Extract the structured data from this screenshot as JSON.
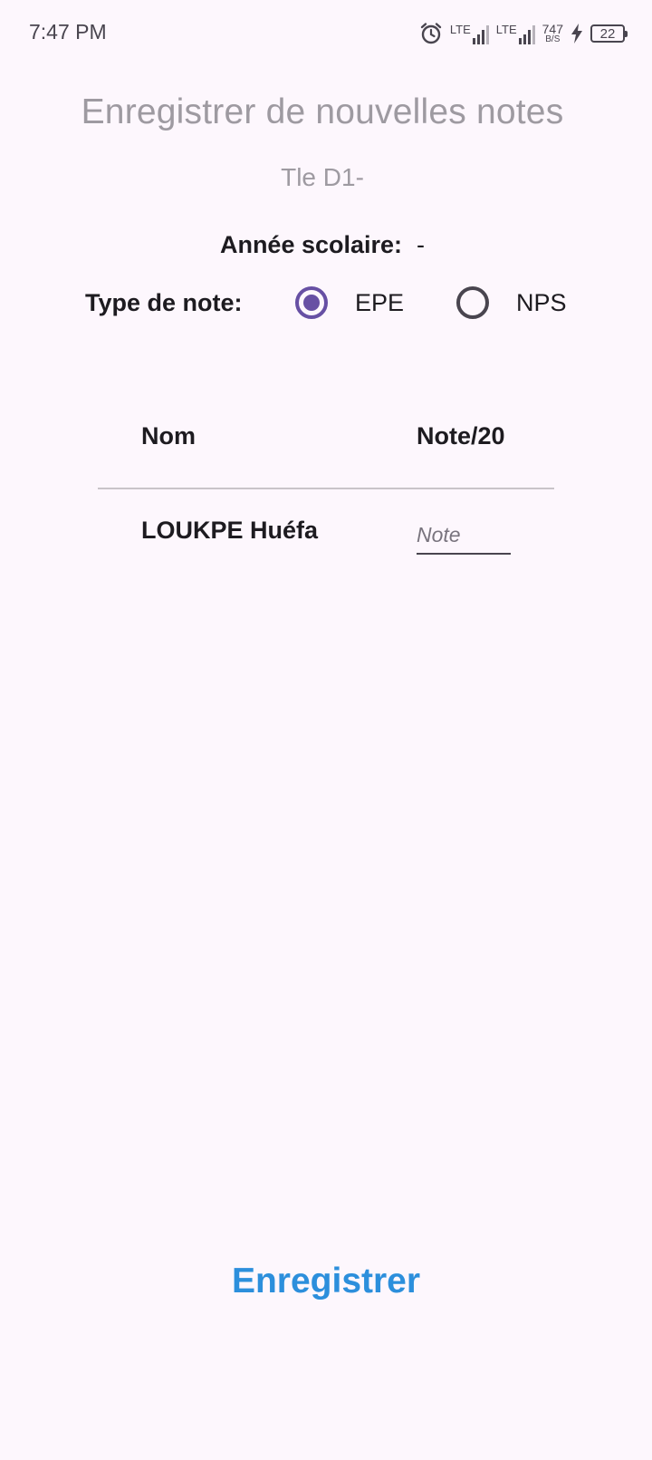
{
  "status_bar": {
    "time": "7:47 PM",
    "lte1": "LTE",
    "lte2": "LTE",
    "net_speed_value": "747",
    "net_speed_unit": "B/S",
    "battery": "22"
  },
  "header": {
    "title": "Enregistrer de nouvelles notes",
    "class_name": "Tle D1-"
  },
  "school_year": {
    "label": "Année scolaire:",
    "value": "-"
  },
  "note_type": {
    "label": "Type de note:",
    "options": [
      {
        "label": "EPE",
        "selected": true
      },
      {
        "label": "NPS",
        "selected": false
      }
    ]
  },
  "table": {
    "columns": [
      "Nom",
      "Note/20"
    ],
    "rows": [
      {
        "name": "LOUKPE Huéfa",
        "note_placeholder": "Note",
        "note_value": ""
      }
    ]
  },
  "actions": {
    "save_label": "Enregistrer"
  },
  "colors": {
    "background": "#fdf7fd",
    "accent": "#6750a4",
    "button": "#2c8fdc",
    "muted_text": "#9e9aa1"
  }
}
